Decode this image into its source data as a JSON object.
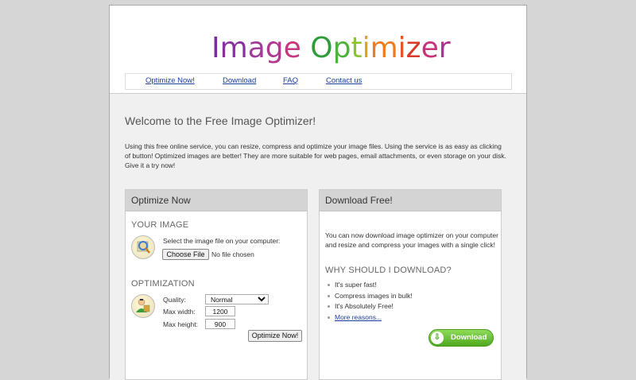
{
  "logo": {
    "letters": [
      "I",
      "m",
      "a",
      "g",
      "e",
      " ",
      "O",
      "p",
      "t",
      "i",
      "m",
      "i",
      "z",
      "e",
      "r"
    ],
    "colors": [
      "#7a2e9e",
      "#8a2fa0",
      "#a23a9b",
      "#b1388f",
      "#c9357f",
      "#fff",
      "#2f9e3a",
      "#4bb33a",
      "#8cc431",
      "#e0a51f",
      "#ef7b1f",
      "#e8531f",
      "#d83a2a",
      "#c7327a",
      "#b0308f"
    ]
  },
  "nav": {
    "items": [
      "Optimize Now!",
      "Download",
      "FAQ",
      "Contact us"
    ]
  },
  "welcome": {
    "title": "Welcome to the Free Image Optimizer!",
    "intro": "Using this free online service, you can resize, compress and optimize your image files. Using the service is as easy as clicking of button! Optimized images are better! They are more suitable for web pages, email attachments, or even storage on your disk. Give it a try now!"
  },
  "optimize_panel": {
    "title": "Optimize Now",
    "your_image_heading": "YOUR IMAGE",
    "select_text": "Select the image file on your computer:",
    "choose_file_label": "Choose File",
    "no_file_text": "No file chosen",
    "optimization_heading": "OPTIMIZATION",
    "quality_label": "Quality:",
    "quality_value": "Normal",
    "max_width_label": "Max width:",
    "max_width_value": "1200",
    "max_height_label": "Max height:",
    "max_height_value": "900",
    "submit_label": "Optimize Now!"
  },
  "download_panel": {
    "title": "Download Free!",
    "description": "You can now download image optimizer on your computer and resize and compress your images with a single click!",
    "why_heading": "WHY SHOULD I DOWNLOAD?",
    "reasons": [
      "It's super fast!",
      "Compress images in bulk!",
      "It's Absolutely Free!"
    ],
    "more_link": "More reasons...",
    "download_button_label": "Download",
    "accent_color": "#4ea81f"
  }
}
